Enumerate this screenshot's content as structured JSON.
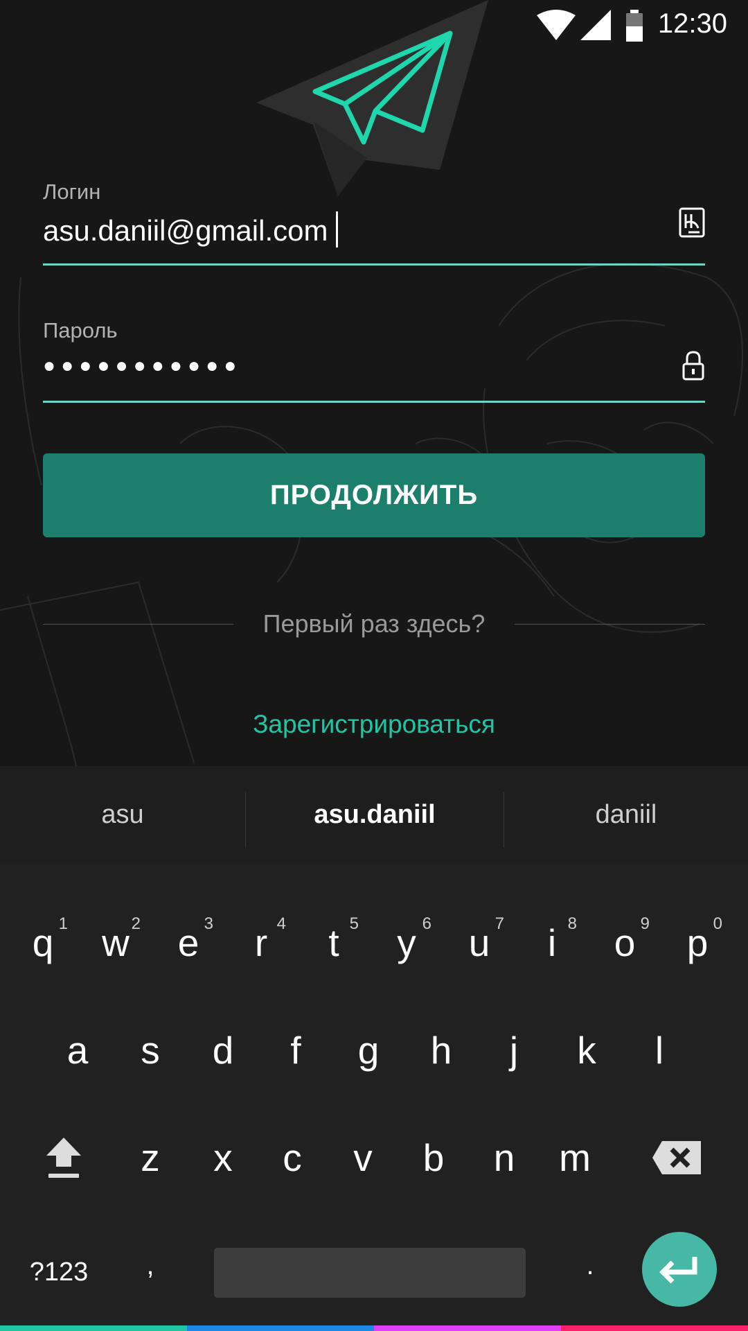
{
  "status_bar": {
    "time": "12:30"
  },
  "login": {
    "label": "Логин",
    "value": "asu.daniil@gmail.com"
  },
  "password": {
    "label": "Пароль",
    "value": "●●●●●●●●●●●"
  },
  "continue_button": "ПРОДОЛЖИТЬ",
  "first_time_text": "Первый раз здесь?",
  "register_link": "Зарегистрироваться",
  "suggestions": [
    "asu",
    "asu.daniil",
    "daniil"
  ],
  "keyboard": {
    "row1": [
      {
        "key": "q",
        "hint": "1"
      },
      {
        "key": "w",
        "hint": "2"
      },
      {
        "key": "e",
        "hint": "3"
      },
      {
        "key": "r",
        "hint": "4"
      },
      {
        "key": "t",
        "hint": "5"
      },
      {
        "key": "y",
        "hint": "6"
      },
      {
        "key": "u",
        "hint": "7"
      },
      {
        "key": "i",
        "hint": "8"
      },
      {
        "key": "o",
        "hint": "9"
      },
      {
        "key": "p",
        "hint": "0"
      }
    ],
    "row2": [
      "a",
      "s",
      "d",
      "f",
      "g",
      "h",
      "j",
      "k",
      "l"
    ],
    "row3": [
      "z",
      "x",
      "c",
      "v",
      "b",
      "n",
      "m"
    ],
    "symbols_key": "?123",
    "comma_key": ",",
    "period_key": "."
  },
  "colors": {
    "accent": "#22c5a2",
    "button": "#1b7f6b",
    "underline": "#6fd4c3",
    "enter": "#47b8a6",
    "strip": [
      "#1fc6a5",
      "#1e88e5",
      "#e040fb",
      "#ff1f6b"
    ]
  }
}
